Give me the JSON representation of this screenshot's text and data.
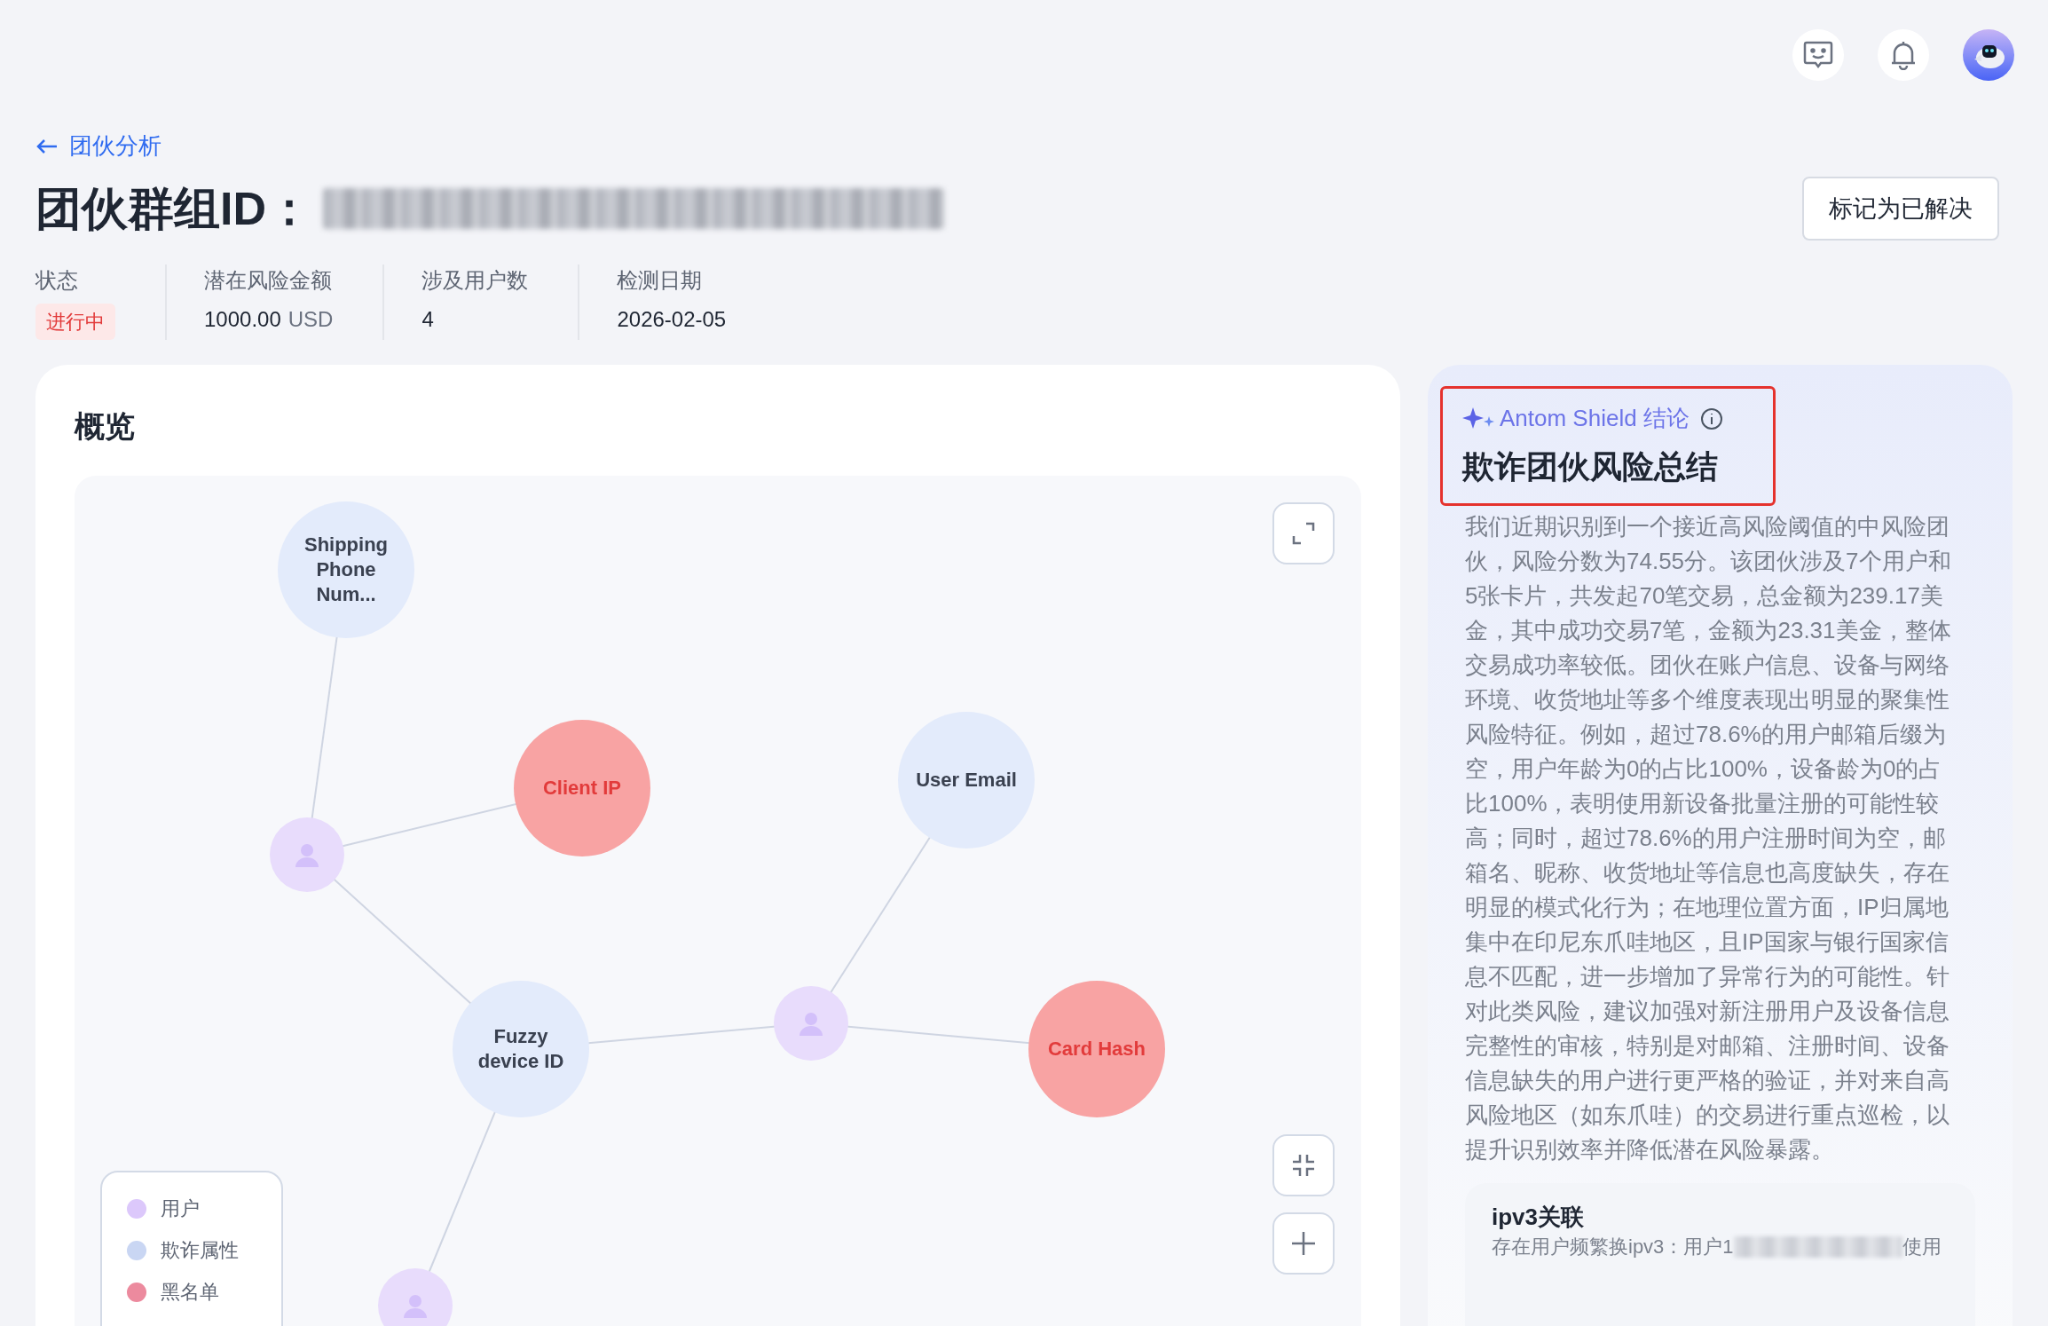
{
  "header": {
    "back_link": "团伙分析",
    "title": "团伙群组ID：",
    "resolve_button": "标记为已解决"
  },
  "stats": [
    {
      "label": "状态",
      "kind": "badge",
      "value": "进行中"
    },
    {
      "label": "潜在风险金额",
      "kind": "amount",
      "value": "1000.00",
      "unit": "USD"
    },
    {
      "label": "涉及用户数",
      "kind": "text",
      "value": "4"
    },
    {
      "label": "检测日期",
      "kind": "text",
      "value": "2026-02-05"
    }
  ],
  "overview": {
    "title": "概览",
    "nodes": [
      {
        "kind": "attribute",
        "label": "Shipping Phone Num..."
      },
      {
        "kind": "user"
      },
      {
        "kind": "blacklist",
        "label": "Client IP"
      },
      {
        "kind": "attribute",
        "label": "User Email"
      },
      {
        "kind": "attribute",
        "label": "Fuzzy device ID"
      },
      {
        "kind": "user"
      },
      {
        "kind": "blacklist",
        "label": "Card Hash"
      },
      {
        "kind": "user"
      }
    ],
    "legend": [
      {
        "label": "用户",
        "color": "#dcc8fb"
      },
      {
        "label": "欺诈属性",
        "color": "#c9d6f3"
      },
      {
        "label": "黑名单",
        "color": "#ec8a9e"
      }
    ]
  },
  "conclusion": {
    "badge": "Antom Shield 结论",
    "title": "欺诈团伙风险总结",
    "body": "我们近期识别到一个接近高风险阈值的中风险团伙，风险分数为74.55分。该团伙涉及7个用户和5张卡片，共发起70笔交易，总金额为239.17美金，其中成功交易7笔，金额为23.31美金，整体交易成功率较低。团伙在账户信息、设备与网络环境、收货地址等多个维度表现出明显的聚集性风险特征。例如，超过78.6%的用户邮箱后缀为空，用户年龄为0的占比100%，设备龄为0的占比100%，表明使用新设备批量注册的可能性较高；同时，超过78.6%的用户注册时间为空，邮箱名、昵称、收货地址等信息也高度缺失，存在明显的模式化行为；在地理位置方面，IP归属地集中在印尼东爪哇地区，且IP国家与银行国家信息不匹配，进一步增加了异常行为的可能性。针对此类风险，建议加强对新注册用户及设备信息完整性的审核，特别是对邮箱、注册时间、设备信息缺失的用户进行更严格的验证，并对来自高风险地区（如东爪哇）的交易进行重点巡检，以提升识别效率并降低潜在风险暴露。",
    "card": {
      "title": "ipv3关联",
      "text_before": "存在用户频繁换ipv3：用户1",
      "text_after": "使用"
    }
  }
}
